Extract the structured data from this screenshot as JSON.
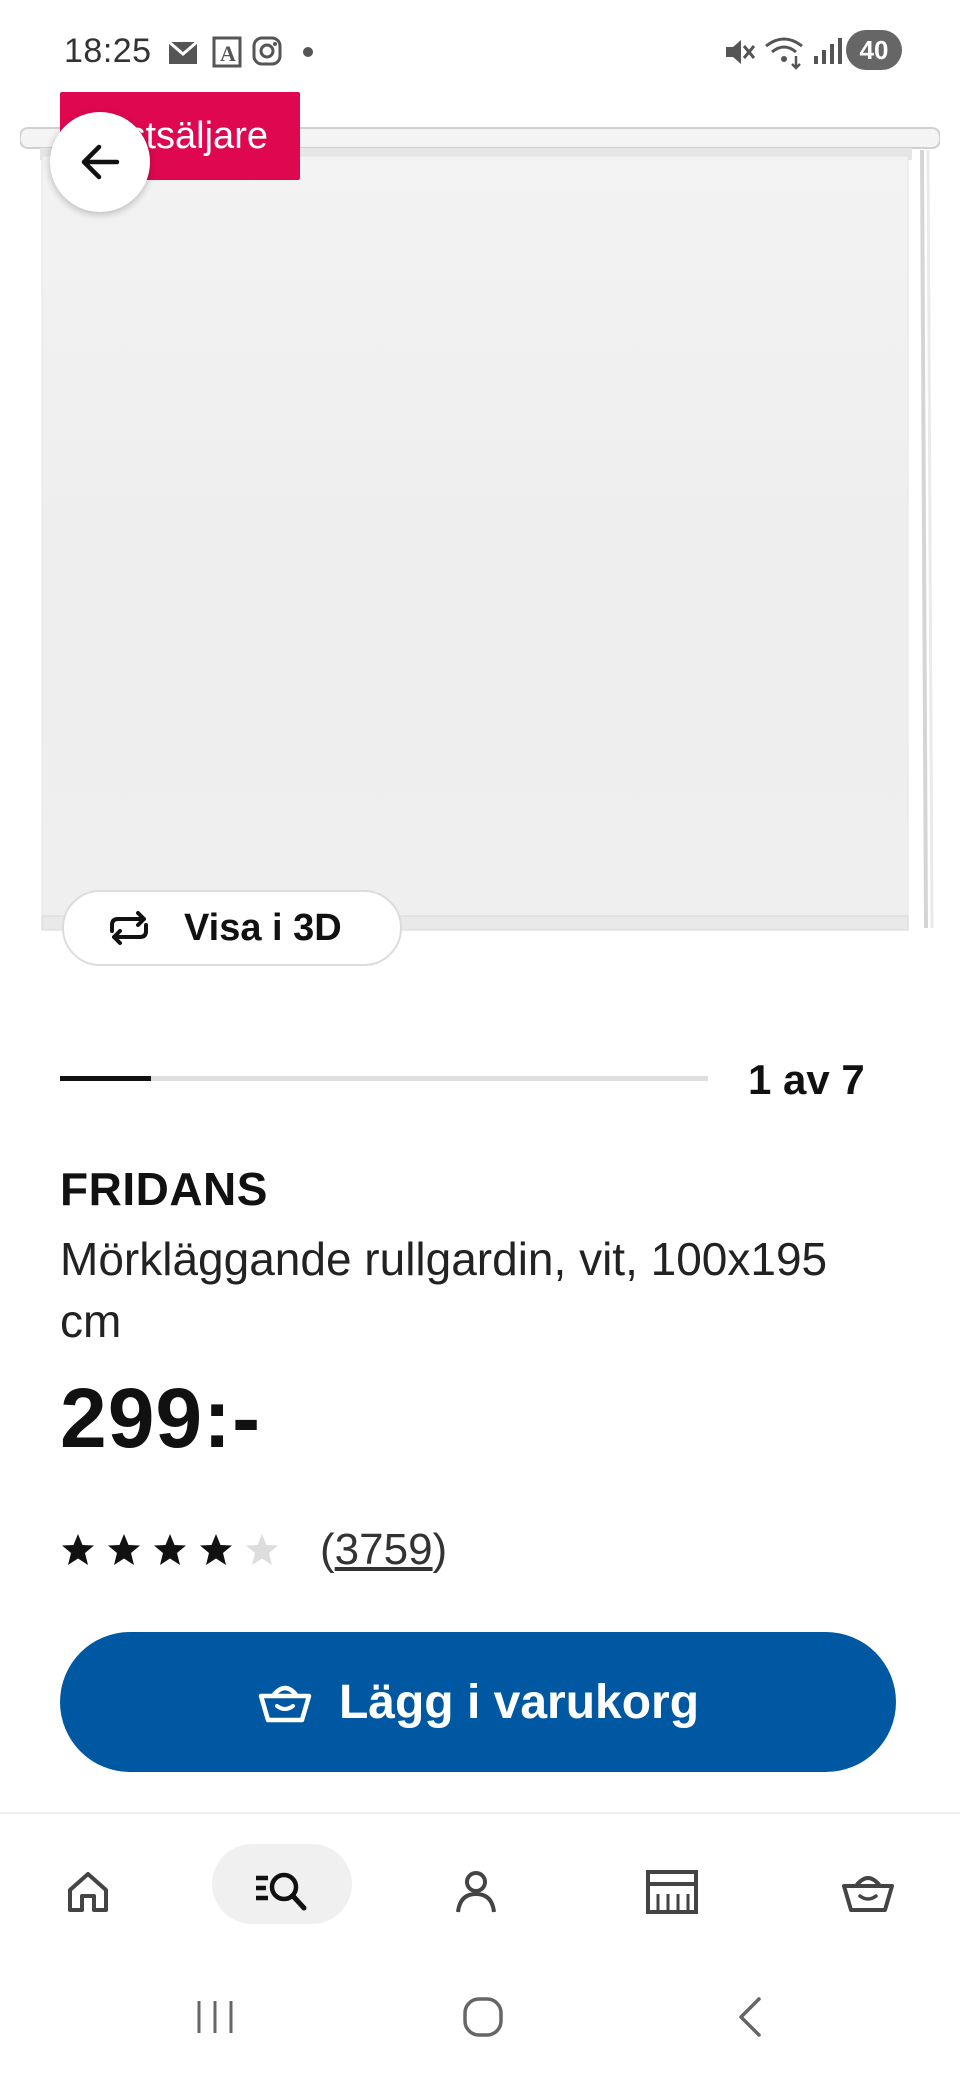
{
  "status_bar": {
    "time": "18:25",
    "battery": "40",
    "icons": [
      "mail-icon",
      "font-app-icon",
      "instagram-icon",
      "dot-icon",
      "mute-icon",
      "wifi-icon",
      "signal-icon"
    ]
  },
  "product": {
    "badge": "Bästsäljare",
    "view_3d_label": "Visa i 3D",
    "image_counter": "1 av 7",
    "image_progress": 0.14,
    "brand": "FRIDANS",
    "description": "Mörkläggande rullgardin, vit, 100x195 cm",
    "price": "299:-",
    "rating": 4,
    "rating_max": 5,
    "review_count_open": "(",
    "review_count": "3759",
    "review_count_close": ")"
  },
  "actions": {
    "add_to_cart_label": "Lägg i varukorg"
  },
  "bottom_nav": {
    "items": [
      "home-icon",
      "search-icon",
      "profile-icon",
      "store-icon",
      "basket-icon"
    ],
    "active": "search-icon"
  },
  "colors": {
    "accent": "#0058a3",
    "badge": "#e00751",
    "text": "#111111"
  }
}
